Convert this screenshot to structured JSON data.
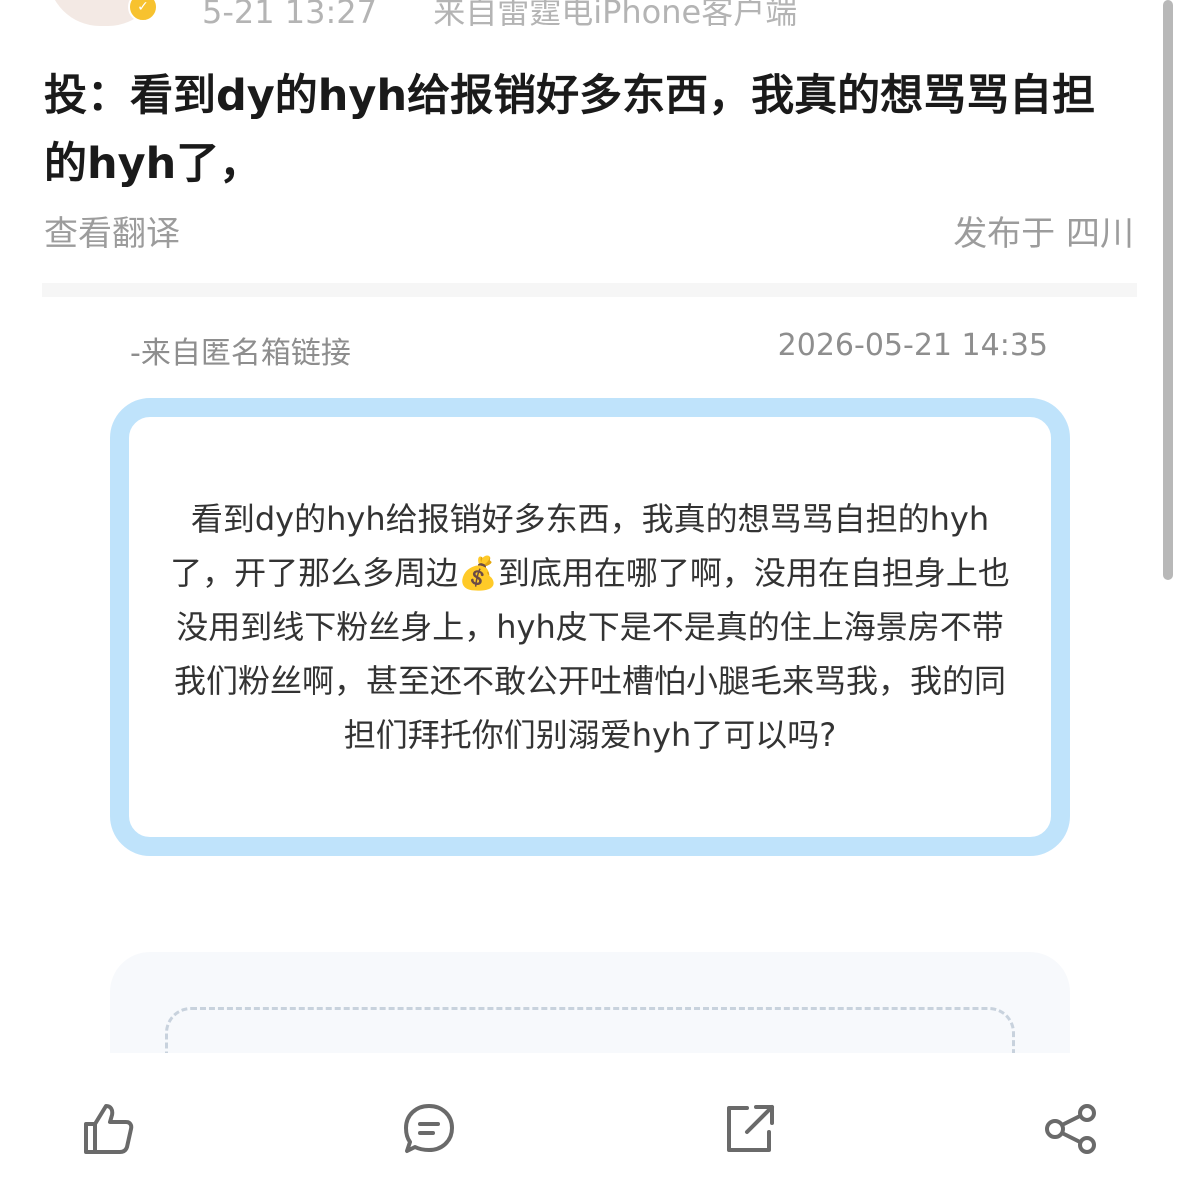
{
  "header": {
    "time": "5-21 13:27",
    "source": "来自雷霆电iPhone客户端"
  },
  "post": {
    "title": "投：看到dy的hyh给报销好多东西，我真的想骂骂自担的hyh了，",
    "translate_label": "查看翻译",
    "location": "发布于 四川"
  },
  "card": {
    "source_label": "-来自匿名箱链接",
    "timestamp": "2026-05-21 14:35",
    "message": "看到dy的hyh给报销好多东西，我真的想骂骂自担的hyh了，开了那么多周边💰到底用在哪了啊，没用在自担身上也没用到线下粉丝身上，hyh皮下是不是真的住上海景房不带我们粉丝啊，甚至还不敢公开吐槽怕小腿毛来骂我，我的同担们拜托你们别溺爱hyh了可以吗?"
  },
  "actions": {
    "icons": [
      "thumbs-up-icon",
      "comment-icon",
      "repost-icon",
      "share-icon"
    ]
  },
  "colors": {
    "bubble_border": "#bfe3fb",
    "badge": "#f7c22f"
  }
}
